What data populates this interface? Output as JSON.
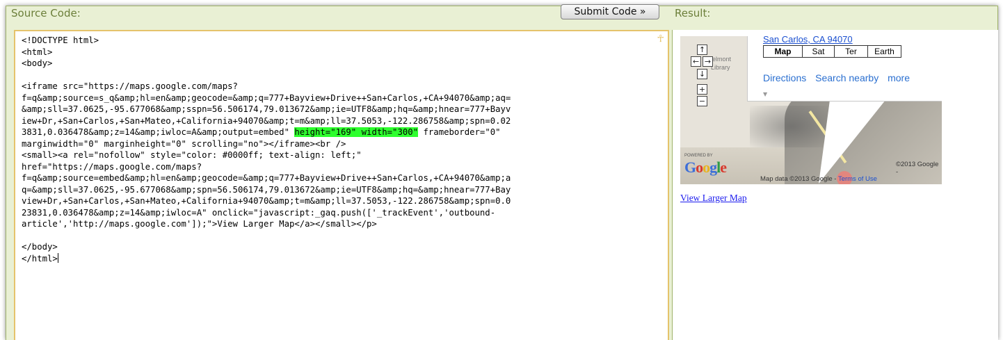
{
  "source_panel": {
    "header": "Source Code:",
    "submit_label": "Submit Code »",
    "code_lines": [
      "<!DOCTYPE html>",
      "<html>",
      "<body>",
      "",
      "<iframe src=\"https://maps.google.com/maps?",
      "f=q&amp;source=s_q&amp;hl=en&amp;geocode=&amp;q=777+Bayview+Drive++San+Carlos,+CA+94070&amp;aq=",
      "&amp;sll=37.0625,-95.677068&amp;sspn=56.506174,79.013672&amp;ie=UTF8&amp;hq=&amp;hnear=777+Bayv",
      "iew+Dr,+San+Carlos,+San+Mateo,+California+94070&amp;t=m&amp;ll=37.5053,-122.286758&amp;spn=0.02",
      "3831,0.036478&amp;z=14&amp;iwloc=A&amp;output=embed\" height=\"169\" width=\"300\" frameborder=\"0\"",
      "marginwidth=\"0\" marginheight=\"0\" scrolling=\"no\"></iframe><br />",
      "<small><a rel=\"nofollow\" style=\"color: #0000ff; text-align: left;\"",
      "href=\"https://maps.google.com/maps?",
      "f=q&amp;source=embed&amp;hl=en&amp;geocode=&amp;q=777+Bayview+Drive++San+Carlos,+CA+94070&amp;a",
      "q=&amp;sll=37.0625,-95.677068&amp;spn=56.506174,79.013672&amp;ie=UTF8&amp;hq=&amp;hnear=777+Bay",
      "view+Dr,+San+Carlos,+San+Mateo,+California+94070&amp;t=m&amp;ll=37.5053,-122.286758&amp;spn=0.0",
      "23831,0.036478&amp;z=14&amp;iwloc=A\" onclick=\"javascript:_gaq.push(['_trackEvent','outbound-",
      "article','http://maps.google.com']);\">View Larger Map</a></small></p>",
      "",
      "</body>",
      "</html>"
    ],
    "highlight": "height=\"169\" width=\"300\""
  },
  "result_panel": {
    "header": "Result:",
    "map": {
      "address_link": "San Carlos, CA 94070",
      "map_types": [
        "Map",
        "Sat",
        "Ter",
        "Earth"
      ],
      "active_map_type": "Map",
      "bubble_links": [
        "Directions",
        "Search nearby",
        "more"
      ],
      "place_labels": [
        "Belmont",
        "Library"
      ],
      "powered_by": "POWERED BY",
      "logo": "Google",
      "attribution": "Map data ©2013 Google -",
      "terms": "Terms of Use",
      "copyright": "©2013 Google -",
      "nav_controls": [
        "↑",
        "←",
        "→",
        "↓",
        "+",
        "−"
      ]
    },
    "view_larger_link": "View Larger Map"
  },
  "colors": {
    "frame_bg": "#e9f0d4",
    "header_text": "#6c7f3a",
    "editor_border": "#e5c36b",
    "highlight": "#2eff2e",
    "link": "#1a1aee"
  }
}
